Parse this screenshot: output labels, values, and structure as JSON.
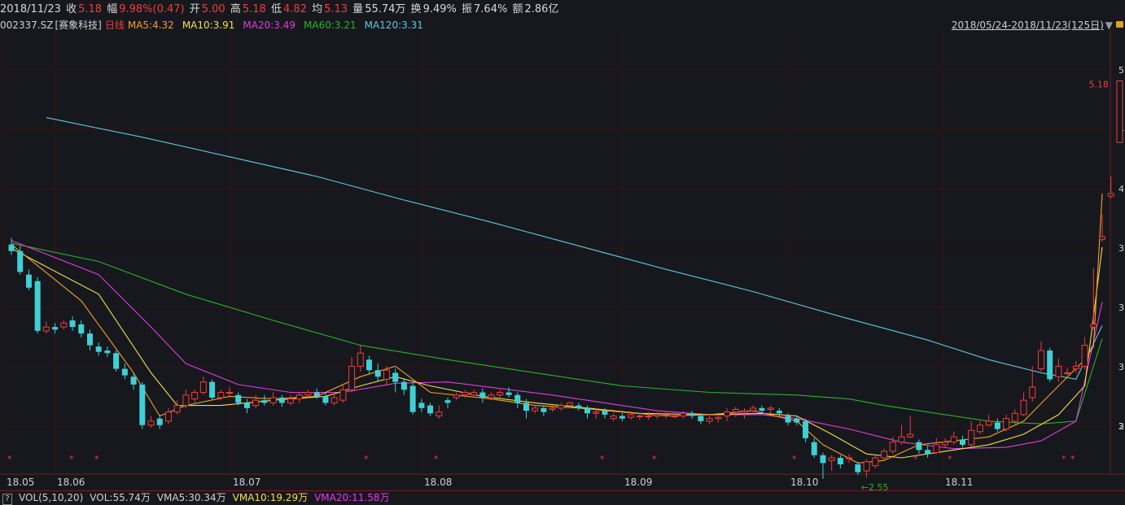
{
  "quote": {
    "date": "2018/11/23",
    "close_label": "收",
    "close": "5.18",
    "amp_label": "幅",
    "amp": "9.98%(0.47)",
    "open_label": "开",
    "open": "5.00",
    "high_label": "高",
    "high": "5.18",
    "low_label": "低",
    "low": "4.82",
    "avg_label": "均",
    "avg": "5.13",
    "vol_label": "量",
    "vol": "55.74万",
    "turnover_label": "换",
    "turnover": "9.49%",
    "swing_label": "振",
    "swing": "7.64%",
    "amount_label": "额",
    "amount": "2.86亿"
  },
  "ma_bar": {
    "code": "002337.SZ",
    "name": "[赛象科技]",
    "period": "日线",
    "ma5": "MA5:4.32",
    "ma10": "MA10:3.91",
    "ma20": "MA20:3.49",
    "ma60": "MA60:3.21",
    "ma120": "MA120:3.31"
  },
  "range": {
    "text": "2018/05/24-2018/11/23(125日)"
  },
  "vol_bar": {
    "help": "?",
    "params": "VOL(5,10,20)",
    "vol": "VOL:55.74万",
    "vma5": "VMA5:30.34万",
    "vma10": "VMA10:19.29万",
    "vma20": "VMA20:11.58万"
  },
  "colors": {
    "up": "#f23c3c",
    "down": "#3fd0d6",
    "ma5": "#f5a025",
    "ma10": "#f0e04a",
    "ma20": "#e23ce2",
    "ma60": "#28b428",
    "ma120": "#5ec8e0",
    "grid": "#3b0f0f"
  },
  "chart_data": {
    "type": "candlestick",
    "ylim": [
      2.3,
      5.5
    ],
    "y_tick_labels": [
      "5.",
      "4.",
      "4.",
      "3.",
      "3.",
      "3.",
      "3.",
      "2."
    ],
    "x_tick_labels": [
      "18.05",
      "18.06",
      "18.07",
      "18.08",
      "18.09",
      "18.10",
      "18.11"
    ],
    "last_price_label": "5.18",
    "low_annotation": "2.55",
    "candles": [
      [
        3.93,
        3.88,
        3.98,
        3.85
      ],
      [
        3.88,
        3.72,
        3.92,
        3.7
      ],
      [
        3.7,
        3.6,
        3.74,
        3.58
      ],
      [
        3.65,
        3.27,
        3.68,
        3.25
      ],
      [
        3.27,
        3.3,
        3.34,
        3.25
      ],
      [
        3.3,
        3.28,
        3.33,
        3.25
      ],
      [
        3.3,
        3.33,
        3.35,
        3.28
      ],
      [
        3.35,
        3.3,
        3.38,
        3.27
      ],
      [
        3.32,
        3.25,
        3.35,
        3.22
      ],
      [
        3.25,
        3.16,
        3.28,
        3.12
      ],
      [
        3.15,
        3.11,
        3.18,
        3.08
      ],
      [
        3.12,
        3.1,
        3.15,
        3.07
      ],
      [
        3.1,
        2.98,
        3.12,
        2.96
      ],
      [
        2.98,
        2.93,
        3.02,
        2.9
      ],
      [
        2.92,
        2.86,
        2.95,
        2.82
      ],
      [
        2.86,
        2.55,
        2.88,
        2.52
      ],
      [
        2.55,
        2.58,
        2.62,
        2.53
      ],
      [
        2.6,
        2.55,
        2.63,
        2.52
      ],
      [
        2.58,
        2.65,
        2.68,
        2.56
      ],
      [
        2.65,
        2.7,
        2.74,
        2.63
      ],
      [
        2.7,
        2.78,
        2.82,
        2.68
      ],
      [
        2.75,
        2.8,
        2.82,
        2.72
      ],
      [
        2.8,
        2.88,
        2.92,
        2.78
      ],
      [
        2.88,
        2.76,
        2.9,
        2.74
      ],
      [
        2.76,
        2.8,
        2.82,
        2.74
      ],
      [
        2.8,
        2.8,
        2.84,
        2.77
      ],
      [
        2.78,
        2.72,
        2.8,
        2.7
      ],
      [
        2.72,
        2.68,
        2.75,
        2.64
      ],
      [
        2.7,
        2.74,
        2.78,
        2.68
      ],
      [
        2.74,
        2.72,
        2.78,
        2.7
      ],
      [
        2.72,
        2.76,
        2.8,
        2.7
      ],
      [
        2.76,
        2.72,
        2.78,
        2.69
      ],
      [
        2.72,
        2.75,
        2.78,
        2.7
      ],
      [
        2.75,
        2.78,
        2.8,
        2.72
      ],
      [
        2.78,
        2.8,
        2.82,
        2.76
      ],
      [
        2.8,
        2.77,
        2.83,
        2.75
      ],
      [
        2.77,
        2.72,
        2.8,
        2.7
      ],
      [
        2.72,
        2.76,
        2.8,
        2.7
      ],
      [
        2.74,
        2.82,
        2.86,
        2.72
      ],
      [
        2.82,
        3.0,
        3.07,
        2.8
      ],
      [
        3.0,
        3.1,
        3.16,
        2.96
      ],
      [
        3.05,
        2.97,
        3.08,
        2.94
      ],
      [
        2.97,
        2.92,
        3.02,
        2.88
      ],
      [
        2.9,
        2.97,
        3.0,
        2.85
      ],
      [
        2.95,
        2.88,
        2.98,
        2.8
      ],
      [
        2.88,
        2.82,
        2.9,
        2.78
      ],
      [
        2.85,
        2.65,
        2.88,
        2.63
      ],
      [
        2.72,
        2.68,
        2.75,
        2.65
      ],
      [
        2.7,
        2.64,
        2.72,
        2.62
      ],
      [
        2.62,
        2.65,
        2.7,
        2.6
      ],
      [
        2.74,
        2.72,
        2.76,
        2.68
      ],
      [
        2.76,
        2.78,
        2.8,
        2.74
      ],
      [
        2.78,
        2.8,
        2.82,
        2.76
      ],
      [
        2.78,
        2.8,
        2.82,
        2.76
      ],
      [
        2.8,
        2.76,
        2.83,
        2.72
      ],
      [
        2.76,
        2.78,
        2.8,
        2.74
      ],
      [
        2.78,
        2.8,
        2.82,
        2.76
      ],
      [
        2.8,
        2.78,
        2.84,
        2.76
      ],
      [
        2.78,
        2.72,
        2.8,
        2.68
      ],
      [
        2.72,
        2.66,
        2.75,
        2.6
      ],
      [
        2.66,
        2.68,
        2.7,
        2.64
      ],
      [
        2.68,
        2.65,
        2.7,
        2.62
      ],
      [
        2.67,
        2.68,
        2.7,
        2.65
      ],
      [
        2.68,
        2.7,
        2.72,
        2.66
      ],
      [
        2.7,
        2.72,
        2.73,
        2.68
      ],
      [
        2.7,
        2.68,
        2.72,
        2.66
      ],
      [
        2.68,
        2.64,
        2.7,
        2.6
      ],
      [
        2.64,
        2.65,
        2.68,
        2.6
      ],
      [
        2.66,
        2.63,
        2.68,
        2.6
      ],
      [
        2.6,
        2.62,
        2.64,
        2.58
      ],
      [
        2.62,
        2.6,
        2.64,
        2.58
      ],
      [
        2.61,
        2.63,
        2.64,
        2.59
      ],
      [
        2.62,
        2.62,
        2.64,
        2.59
      ],
      [
        2.62,
        2.62,
        2.65,
        2.59
      ],
      [
        2.62,
        2.63,
        2.65,
        2.6
      ],
      [
        2.63,
        2.63,
        2.65,
        2.6
      ],
      [
        2.62,
        2.62,
        2.65,
        2.6
      ],
      [
        2.62,
        2.64,
        2.66,
        2.6
      ],
      [
        2.64,
        2.62,
        2.66,
        2.6
      ],
      [
        2.62,
        2.58,
        2.64,
        2.56
      ],
      [
        2.58,
        2.6,
        2.62,
        2.56
      ],
      [
        2.6,
        2.61,
        2.62,
        2.57
      ],
      [
        2.62,
        2.65,
        2.68,
        2.58
      ],
      [
        2.65,
        2.67,
        2.69,
        2.61
      ],
      [
        2.65,
        2.66,
        2.68,
        2.6
      ],
      [
        2.66,
        2.68,
        2.7,
        2.63
      ],
      [
        2.68,
        2.66,
        2.7,
        2.63
      ],
      [
        2.67,
        2.68,
        2.7,
        2.64
      ],
      [
        2.66,
        2.64,
        2.68,
        2.62
      ],
      [
        2.62,
        2.57,
        2.64,
        2.55
      ],
      [
        2.6,
        2.57,
        2.62,
        2.55
      ],
      [
        2.58,
        2.45,
        2.6,
        2.42
      ],
      [
        2.42,
        2.32,
        2.45,
        2.3
      ],
      [
        2.32,
        2.26,
        2.34,
        2.14
      ],
      [
        2.28,
        2.3,
        2.32,
        2.2
      ],
      [
        2.3,
        2.25,
        2.32,
        2.22
      ],
      [
        2.3,
        2.3,
        2.33,
        2.26
      ],
      [
        2.25,
        2.19,
        2.27,
        2.17
      ],
      [
        2.2,
        2.27,
        2.29,
        2.15
      ],
      [
        2.24,
        2.3,
        2.32,
        2.22
      ],
      [
        2.3,
        2.35,
        2.37,
        2.28
      ],
      [
        2.35,
        2.42,
        2.46,
        2.33
      ],
      [
        2.42,
        2.46,
        2.55,
        2.4
      ],
      [
        2.46,
        2.48,
        2.62,
        2.45
      ],
      [
        2.42,
        2.36,
        2.44,
        2.33
      ],
      [
        2.36,
        2.33,
        2.39,
        2.3
      ],
      [
        2.34,
        2.4,
        2.45,
        2.33
      ],
      [
        2.4,
        2.42,
        2.45,
        2.38
      ],
      [
        2.42,
        2.46,
        2.5,
        2.4
      ],
      [
        2.44,
        2.4,
        2.47,
        2.38
      ],
      [
        2.4,
        2.51,
        2.58,
        2.38
      ],
      [
        2.5,
        2.55,
        2.58,
        2.48
      ],
      [
        2.55,
        2.58,
        2.63,
        2.54
      ],
      [
        2.57,
        2.52,
        2.6,
        2.5
      ],
      [
        2.52,
        2.6,
        2.63,
        2.5
      ],
      [
        2.58,
        2.64,
        2.67,
        2.56
      ],
      [
        2.63,
        2.74,
        2.8,
        2.62
      ],
      [
        2.76,
        2.84,
        3.0,
        2.73
      ],
      [
        2.98,
        3.12,
        3.19,
        2.96
      ],
      [
        3.12,
        2.9,
        3.14,
        2.88
      ],
      [
        2.92,
        3.0,
        3.06,
        2.88
      ],
      [
        2.95,
        2.95,
        2.99,
        2.93
      ],
      [
        2.98,
        3.0,
        3.04,
        2.95
      ],
      [
        3.0,
        3.16,
        3.22,
        2.98
      ],
      [
        3.3,
        3.32,
        3.75,
        3.28
      ],
      [
        3.97,
        3.99,
        4.16,
        3.95
      ],
      [
        4.3,
        4.32,
        4.45,
        4.28
      ],
      [
        4.71,
        5.18,
        5.18,
        4.71
      ]
    ],
    "ma": {
      "ma5": [
        [
          0,
          3.93
        ],
        [
          8,
          3.5
        ],
        [
          14,
          2.95
        ],
        [
          17,
          2.62
        ],
        [
          20,
          2.7
        ],
        [
          25,
          2.77
        ],
        [
          30,
          2.75
        ],
        [
          35,
          2.77
        ],
        [
          40,
          2.92
        ],
        [
          44,
          3.0
        ],
        [
          48,
          2.8
        ],
        [
          55,
          2.75
        ],
        [
          60,
          2.7
        ],
        [
          65,
          2.68
        ],
        [
          70,
          2.65
        ],
        [
          75,
          2.62
        ],
        [
          80,
          2.63
        ],
        [
          85,
          2.66
        ],
        [
          90,
          2.58
        ],
        [
          93,
          2.4
        ],
        [
          97,
          2.26
        ],
        [
          100,
          2.28
        ],
        [
          104,
          2.4
        ],
        [
          108,
          2.43
        ],
        [
          112,
          2.46
        ],
        [
          116,
          2.58
        ],
        [
          120,
          2.85
        ],
        [
          123,
          3.05
        ],
        [
          124,
          3.15
        ],
        [
          125,
          4.32
        ]
      ],
      "ma10": [
        [
          0,
          3.9
        ],
        [
          10,
          3.55
        ],
        [
          16,
          2.95
        ],
        [
          19,
          2.7
        ],
        [
          24,
          2.7
        ],
        [
          30,
          2.74
        ],
        [
          36,
          2.77
        ],
        [
          40,
          2.85
        ],
        [
          44,
          2.92
        ],
        [
          48,
          2.85
        ],
        [
          54,
          2.77
        ],
        [
          60,
          2.72
        ],
        [
          66,
          2.68
        ],
        [
          72,
          2.64
        ],
        [
          80,
          2.63
        ],
        [
          86,
          2.64
        ],
        [
          90,
          2.62
        ],
        [
          94,
          2.48
        ],
        [
          98,
          2.33
        ],
        [
          102,
          2.3
        ],
        [
          108,
          2.36
        ],
        [
          112,
          2.4
        ],
        [
          116,
          2.48
        ],
        [
          120,
          2.63
        ],
        [
          123,
          2.85
        ],
        [
          125,
          3.91
        ]
      ],
      "ma20": [
        [
          0,
          3.96
        ],
        [
          10,
          3.7
        ],
        [
          16,
          3.3
        ],
        [
          20,
          3.02
        ],
        [
          26,
          2.86
        ],
        [
          32,
          2.8
        ],
        [
          38,
          2.8
        ],
        [
          44,
          2.87
        ],
        [
          50,
          2.88
        ],
        [
          56,
          2.83
        ],
        [
          62,
          2.78
        ],
        [
          68,
          2.72
        ],
        [
          74,
          2.66
        ],
        [
          80,
          2.63
        ],
        [
          86,
          2.63
        ],
        [
          90,
          2.6
        ],
        [
          96,
          2.52
        ],
        [
          102,
          2.42
        ],
        [
          108,
          2.37
        ],
        [
          114,
          2.38
        ],
        [
          118,
          2.43
        ],
        [
          122,
          2.58
        ],
        [
          125,
          3.49
        ]
      ],
      "ma60": [
        [
          0,
          3.94
        ],
        [
          10,
          3.8
        ],
        [
          20,
          3.55
        ],
        [
          30,
          3.35
        ],
        [
          40,
          3.16
        ],
        [
          50,
          3.05
        ],
        [
          60,
          2.95
        ],
        [
          70,
          2.85
        ],
        [
          80,
          2.8
        ],
        [
          90,
          2.78
        ],
        [
          96,
          2.75
        ],
        [
          100,
          2.7
        ],
        [
          106,
          2.64
        ],
        [
          112,
          2.58
        ],
        [
          118,
          2.56
        ],
        [
          122,
          2.58
        ],
        [
          125,
          3.21
        ]
      ],
      "ma120": [
        [
          4,
          4.9
        ],
        [
          15,
          4.75
        ],
        [
          25,
          4.6
        ],
        [
          35,
          4.45
        ],
        [
          45,
          4.27
        ],
        [
          55,
          4.1
        ],
        [
          65,
          3.92
        ],
        [
          75,
          3.74
        ],
        [
          85,
          3.57
        ],
        [
          95,
          3.38
        ],
        [
          105,
          3.2
        ],
        [
          112,
          3.05
        ],
        [
          118,
          2.95
        ],
        [
          122,
          2.9
        ],
        [
          125,
          3.31
        ]
      ]
    }
  }
}
